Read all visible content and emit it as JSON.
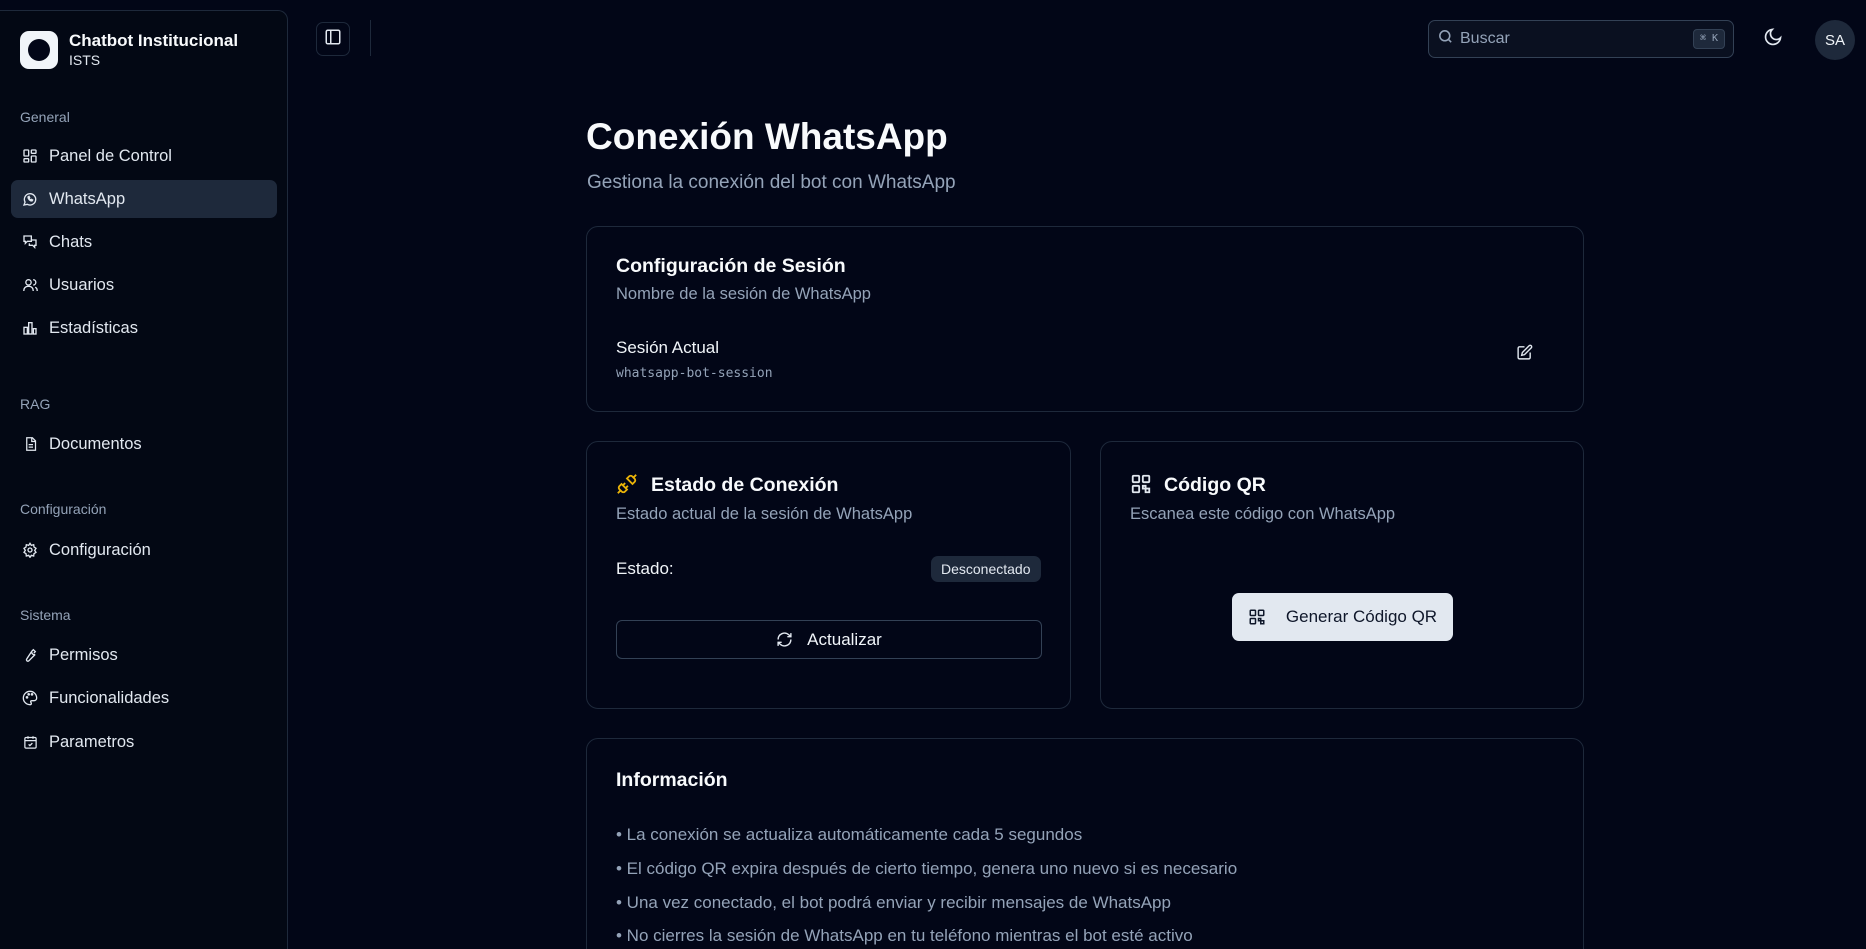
{
  "app": {
    "title": "Chatbot Institucional",
    "subtitle": "ISTS"
  },
  "sidebar": {
    "groups": [
      {
        "label": "General"
      },
      {
        "label": "RAG"
      },
      {
        "label": "Configuración"
      },
      {
        "label": "Sistema"
      }
    ],
    "items": [
      {
        "label": "Panel de Control",
        "icon": "dashboard-icon",
        "active": false
      },
      {
        "label": "WhatsApp",
        "icon": "whatsapp-icon",
        "active": true
      },
      {
        "label": "Chats",
        "icon": "chats-icon",
        "active": false
      },
      {
        "label": "Usuarios",
        "icon": "users-icon",
        "active": false
      },
      {
        "label": "Estadísticas",
        "icon": "bar-chart-icon",
        "active": false
      },
      {
        "label": "Documentos",
        "icon": "document-icon",
        "active": false
      },
      {
        "label": "Configuración",
        "icon": "gear-icon",
        "active": false
      },
      {
        "label": "Permisos",
        "icon": "wrench-icon",
        "active": false
      },
      {
        "label": "Funcionalidades",
        "icon": "palette-icon",
        "active": false
      },
      {
        "label": "Parametros",
        "icon": "calendar-check-icon",
        "active": false
      }
    ]
  },
  "topbar": {
    "search_placeholder": "Buscar",
    "search_shortcut": "⌘ K",
    "avatar_initials": "SA"
  },
  "main": {
    "title": "Conexión WhatsApp",
    "subtitle": "Gestiona la conexión del bot con WhatsApp",
    "session_card": {
      "title": "Configuración de Sesión",
      "description": "Nombre de la sesión de WhatsApp",
      "field_label": "Sesión Actual",
      "field_value": "whatsapp-bot-session"
    },
    "status_card": {
      "title": "Estado de Conexión",
      "description": "Estado actual de la sesión de WhatsApp",
      "status_label": "Estado:",
      "status_value": "Desconectado",
      "refresh_label": "Actualizar"
    },
    "qr_card": {
      "title": "Código QR",
      "description": "Escanea este código con WhatsApp",
      "generate_label": "Generar Código QR"
    },
    "info_card": {
      "title": "Información",
      "lines": [
        "• La conexión se actualiza automáticamente cada 5 segundos",
        "• El código QR expira después de cierto tiempo, genera uno nuevo si es necesario",
        "• Una vez conectado, el bot podrá enviar y recibir mensajes de WhatsApp",
        "• No cierres la sesión de WhatsApp en tu teléfono mientras el bot esté activo"
      ]
    }
  },
  "colors": {
    "background": "#020617",
    "accent_plug": "#eab308",
    "muted_text": "#94a3b8"
  }
}
